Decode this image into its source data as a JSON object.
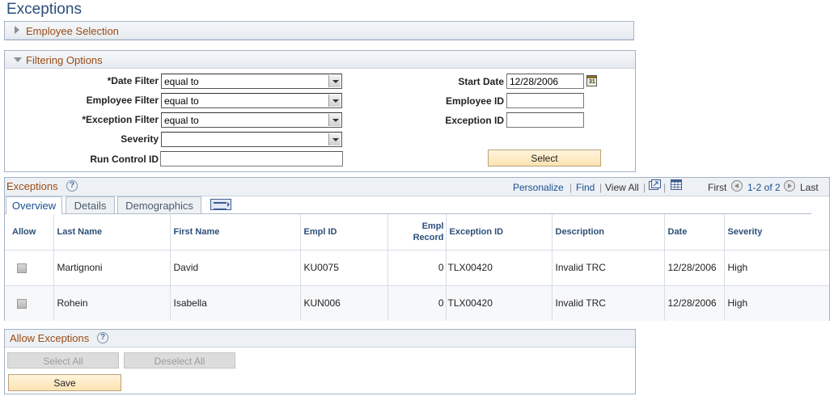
{
  "page": {
    "title": "Exceptions"
  },
  "employee_selection": {
    "title": "Employee Selection"
  },
  "filtering": {
    "title": "Filtering Options",
    "date_filter": {
      "label": "*Date Filter",
      "value": "equal to"
    },
    "employee_filter": {
      "label": "Employee Filter",
      "value": "equal to"
    },
    "exception_filter": {
      "label": "*Exception Filter",
      "value": "equal to"
    },
    "severity": {
      "label": "Severity",
      "value": ""
    },
    "run_control": {
      "label": "Run Control ID",
      "value": ""
    },
    "start_date": {
      "label": "Start Date",
      "value": "12/28/2006"
    },
    "employee_id": {
      "label": "Employee ID",
      "value": ""
    },
    "exception_id": {
      "label": "Exception ID",
      "value": ""
    },
    "select_button": "Select",
    "calendar_icon_text": "31"
  },
  "grid": {
    "title": "Exceptions",
    "help": "?",
    "nav": {
      "personalize": "Personalize",
      "find": "Find",
      "view_all": "View All",
      "sep": "|",
      "first": "First",
      "range": "1-2 of 2",
      "last": "Last"
    },
    "tabs": [
      "Overview",
      "Details",
      "Demographics"
    ],
    "columns": [
      "Allow",
      "Last Name",
      "First Name",
      "Empl ID",
      "Empl Record",
      "Exception ID",
      "Description",
      "Date",
      "Severity"
    ],
    "rows": [
      {
        "last_name": "Martignoni",
        "first_name": "David",
        "empl_id": "KU0075",
        "empl_record": "0",
        "exception_id": "TLX00420",
        "description": "Invalid TRC",
        "date": "12/28/2006",
        "severity": "High"
      },
      {
        "last_name": "Rohein",
        "first_name": "Isabella",
        "empl_id": "KUN006",
        "empl_record": "0",
        "exception_id": "TLX00420",
        "description": "Invalid TRC",
        "date": "12/28/2006",
        "severity": "High"
      }
    ]
  },
  "allow_exceptions": {
    "title": "Allow Exceptions",
    "help": "?",
    "select_all": "Select All",
    "deselect_all": "Deselect All",
    "save": "Save"
  },
  "colors": {
    "accent": "#9a4a13",
    "link": "#1a4f8f",
    "header_text": "#2c4f79",
    "border": "#a3b2c5"
  }
}
